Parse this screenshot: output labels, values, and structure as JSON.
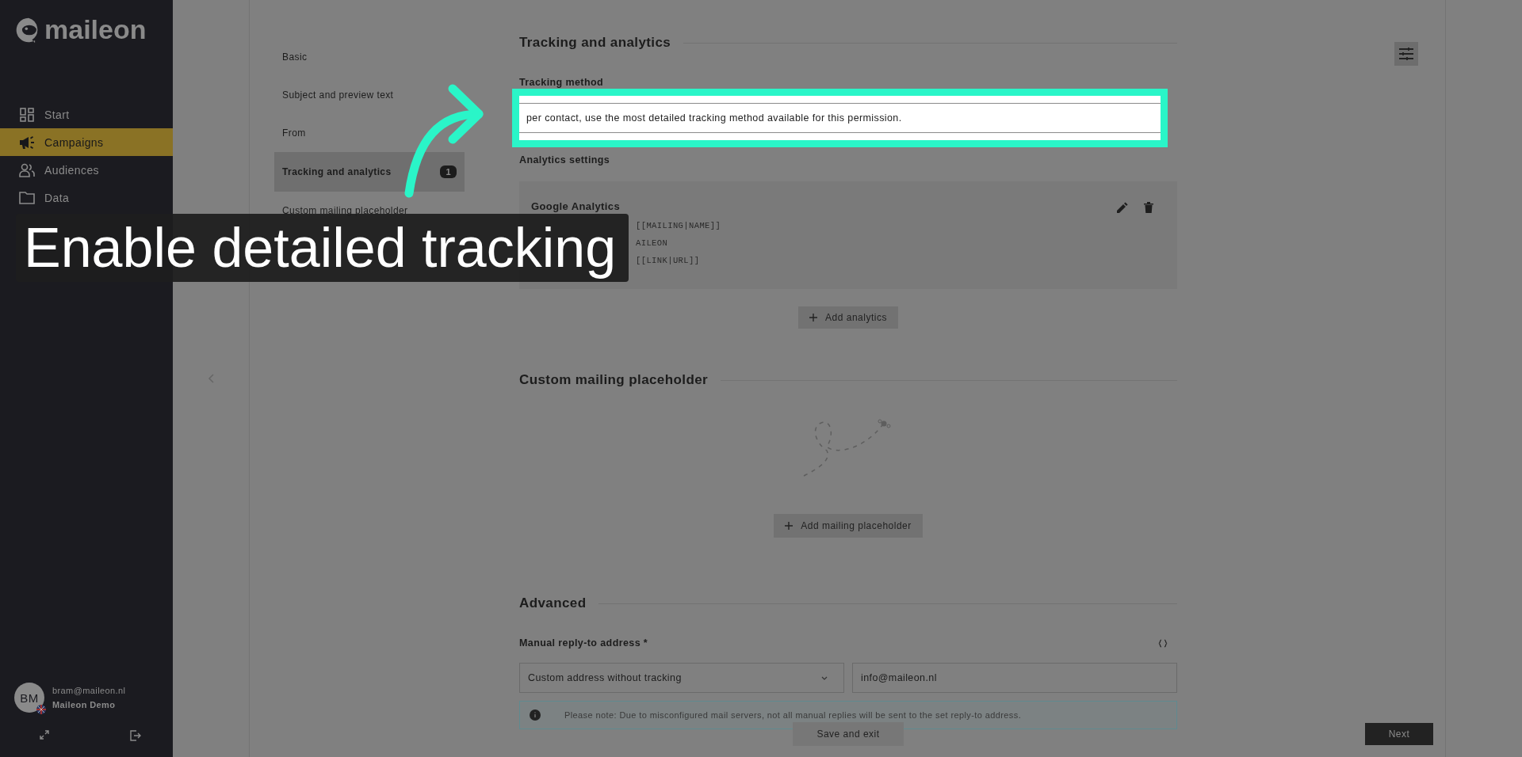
{
  "sidebar": {
    "logo": "maileon",
    "nav": [
      {
        "label": "Start",
        "selected": false
      },
      {
        "label": "Campaigns",
        "selected": true
      },
      {
        "label": "Audiences",
        "selected": false
      },
      {
        "label": "Data",
        "selected": false
      }
    ],
    "user": {
      "initials": "BM",
      "email": "bram@maileon.nl",
      "account": "Maileon Demo"
    }
  },
  "steps": [
    {
      "label": "Basic",
      "selected": false
    },
    {
      "label": "Subject and preview text",
      "selected": false
    },
    {
      "label": "From",
      "selected": false
    },
    {
      "label": "Tracking and analytics",
      "selected": true,
      "badge": "1"
    },
    {
      "label": "Custom mailing placeholder",
      "selected": false
    }
  ],
  "tracking": {
    "heading": "Tracking and analytics",
    "method_label": "Tracking method",
    "method_value": "per contact, use the most detailed tracking method available for this permission.",
    "analytics_label": "Analytics settings",
    "analytics": [
      {
        "name": "Google Analytics",
        "lines": [
          "[[MAILING|NAME]]",
          "AILEON",
          "[[LINK|URL]]"
        ]
      }
    ],
    "add_button": "Add analytics"
  },
  "placeholders": {
    "heading": "Custom mailing placeholder",
    "add_button": "Add mailing placeholder"
  },
  "advanced": {
    "heading": "Advanced",
    "reply_label": "Manual reply-to address *",
    "reply_mode": "Custom address without tracking",
    "reply_address": "info@maileon.nl",
    "note": "Please note: Due to misconfigured mail servers, not all manual replies will be sent to the set reply-to address."
  },
  "footer": {
    "save": "Save and exit",
    "next": "Next"
  },
  "tutorial": {
    "caption": "Enable detailed tracking"
  }
}
